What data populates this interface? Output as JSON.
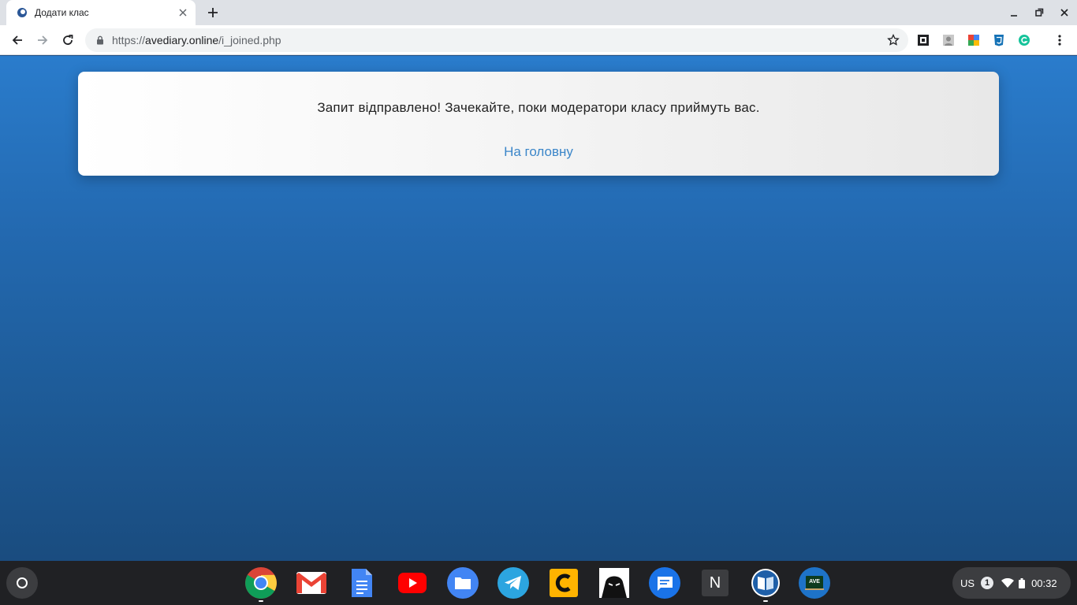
{
  "browser": {
    "tab": {
      "title": "Додати клас"
    },
    "address": {
      "scheme": "https://",
      "host": "avediary.online",
      "path": "/i_joined.php"
    }
  },
  "page": {
    "message": "Запит відправлено! Зачекайте, поки модератори класу приймуть вас.",
    "home_link": "На головну"
  },
  "shelf": {
    "apps": [
      "chrome-icon",
      "gmail-icon",
      "docs-icon",
      "youtube-icon",
      "files-icon",
      "telegram-icon",
      "c-app-icon",
      "hacker-app-icon",
      "messages-icon",
      "n-app-icon",
      "reader-app-icon",
      "avediary-app-icon"
    ],
    "n_app_letter": "N",
    "ave_app_label": "AVE",
    "tray": {
      "ime": "US",
      "notifications": "1",
      "time": "00:32"
    }
  },
  "colors": {
    "page_gradient_top": "#2a7ccc",
    "page_gradient_bottom": "#1a4c7f",
    "link": "#3b86c9"
  }
}
